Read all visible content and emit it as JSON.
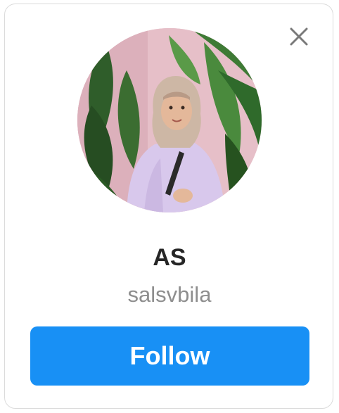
{
  "profile": {
    "display_name": "AS",
    "username": "salsvbila"
  },
  "actions": {
    "follow_label": "Follow",
    "close_icon": "close-icon"
  },
  "colors": {
    "follow_button_bg": "#1890f5",
    "name_text": "#262626",
    "username_text": "#8e8e8e",
    "card_border": "#dbdbdb"
  }
}
